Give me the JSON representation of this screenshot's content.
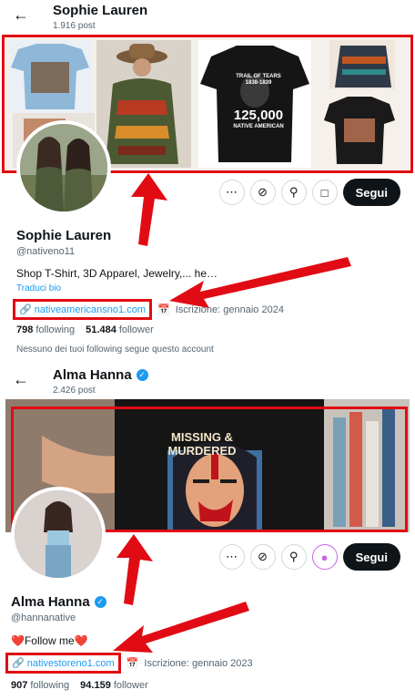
{
  "profile1": {
    "topbar": {
      "name": "Sophie Lauren",
      "posts": "1.916 post"
    },
    "name": "Sophie Lauren",
    "handle": "@nativeno11",
    "bio": "Shop T-Shirt, 3D Apparel, Jewelry,... he…",
    "translate": "Traduci bio",
    "website": "nativeamericansno1.com",
    "joined": "Iscrizione: gennaio 2024",
    "following_count": "798",
    "following_label": "following",
    "followers_count": "51.484",
    "followers_label": "follower",
    "note": "Nessuno dei tuoi following segue questo account",
    "follow_button": "Segui",
    "banner_shirt_text": {
      "line1": "TRAIL OF TEARS",
      "line2": "1838-1839",
      "line3": "125,000",
      "line4": "NATIVE AMERICAN"
    }
  },
  "profile2": {
    "topbar": {
      "name": "Alma Hanna",
      "posts": "2.426 post"
    },
    "name": "Alma Hanna",
    "handle": "@hannanative",
    "bio": "❤️Follow me❤️",
    "website": "nativestoreno1.com",
    "joined": "Iscrizione: gennaio 2023",
    "following_count": "907",
    "following_label": "following",
    "followers_count": "94.159",
    "followers_label": "follower",
    "follow_button": "Segui",
    "banner_shirt_text": "MISSING & MURDERED"
  },
  "icons": [
    "back-arrow-icon",
    "more-icon",
    "mute-icon",
    "search-icon",
    "shop-icon",
    "link-icon",
    "calendar-icon",
    "verified-icon",
    "subscribe-icon"
  ],
  "colors": {
    "highlight": "#e10b14",
    "link": "#1d9bf0",
    "button": "#0f1419",
    "verified": "#1d9bf0"
  }
}
